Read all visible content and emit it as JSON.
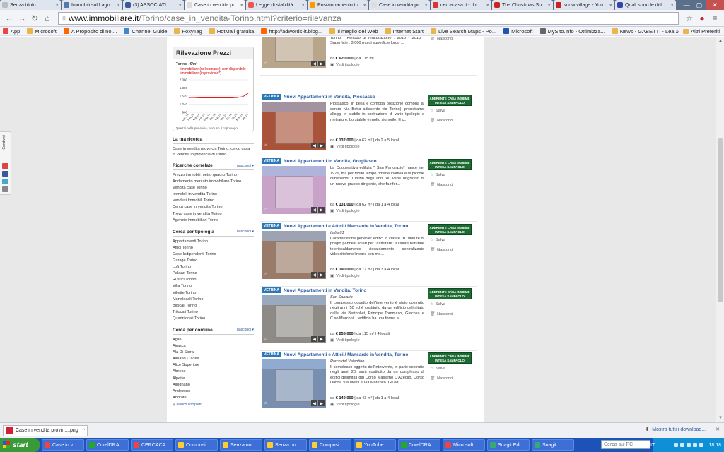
{
  "browser": {
    "tabs": [
      {
        "label": "Senza titolo",
        "color": "#bbb"
      },
      {
        "label": "Immobili sul Lago",
        "color": "#57a"
      },
      {
        "label": "(3) ASSOCIATI",
        "color": "#3b5998"
      },
      {
        "label": "Case in vendita pr",
        "color": "#ddd",
        "active": true
      },
      {
        "label": "Legge di stabilità",
        "color": "#e55"
      },
      {
        "label": "Posizionamento to",
        "color": "#f90"
      },
      {
        "label": "Case in vendita pr",
        "color": "#ddd"
      },
      {
        "label": "cercacasa.it - Il r",
        "color": "#d33"
      },
      {
        "label": "The Christmas So",
        "color": "#c22"
      },
      {
        "label": "snow village - You",
        "color": "#c22"
      },
      {
        "label": "Quali sono le diff",
        "color": "#34a"
      }
    ],
    "window_controls": {
      "minimize": "—",
      "maximize": "▢",
      "close": "✕"
    },
    "nav": {
      "back": "←",
      "forward": "→",
      "reload": "↻",
      "home": "⌂",
      "star": "☆",
      "menu": "≡"
    },
    "url": {
      "host": "www.immobiliare.it",
      "path": "/Torino/case_in_vendita-Torino.html?criterio=rilevanza",
      "page_icon": "▯"
    },
    "bookmarks": [
      {
        "label": "App",
        "color": "#e44"
      },
      {
        "label": "Microsoft",
        "color": "#e8b64c"
      },
      {
        "label": "A Proposito di noi...",
        "color": "#f60"
      },
      {
        "label": "Channel Guide",
        "color": "#48c"
      },
      {
        "label": "FoxyTag",
        "color": "#e8b64c"
      },
      {
        "label": "HotMail gratuita",
        "color": "#e8b64c"
      },
      {
        "label": "http://adwords-it.blog...",
        "color": "#f60"
      },
      {
        "label": "Il meglio del Web",
        "color": "#e8b64c"
      },
      {
        "label": "Internet Start",
        "color": "#e8b64c"
      },
      {
        "label": "Live Search Maps - Po...",
        "color": "#e8b64c"
      },
      {
        "label": "Microsoft",
        "color": "#25a"
      },
      {
        "label": "MySito.info - Ottimizza...",
        "color": "#666"
      },
      {
        "label": "News - GABETTI - Lea...",
        "color": "#e8b64c"
      }
    ],
    "bookmarks_overflow": "»",
    "other_bookmarks": "Altri Preferiti"
  },
  "share": {
    "label": "Condividi",
    "icons": [
      {
        "name": "google-plus",
        "color": "#d44"
      },
      {
        "name": "facebook",
        "color": "#3b5998"
      },
      {
        "name": "twitter",
        "color": "#4ac"
      },
      {
        "name": "email",
        "color": "#888"
      }
    ]
  },
  "sidebar": {
    "rilevazione": {
      "title": "Rilevazione Prezzi",
      "city": "Torino - €/m²",
      "legend1": "— immobiliare (nel comune), non disponibile",
      "legend2": "— immobiliare (in provincia*)",
      "y_ticks": [
        "2.080",
        "1.800",
        "1.520",
        "1.240",
        "960"
      ],
      "note": "*prezzi nella provincia, escluso il capoluogo"
    },
    "tua_ricerca": {
      "title": "La tua ricerca",
      "text": "Case in vendita provincia Torino, cerco casa in vendita in provincia di Torino"
    },
    "ricerche_correlate": {
      "title": "Ricerche correlate",
      "toggle": "nascondi ▾",
      "links": [
        "Prezzo immobili metro quadro Torino",
        "Andamento mercato immobiliare Torino",
        "Vendita case Torino",
        "Immobili in vendita Torino",
        "Vendesi Immobili Torino",
        "Cerca case in vendita Torino",
        "Trova case in vendita Torino",
        "Agenzie immobiliari Torino"
      ]
    },
    "tipologia": {
      "title": "Cerca per tipologia",
      "toggle": "nascondi ▾",
      "links": [
        "Appartamenti Torino",
        "Attici Torino",
        "Case Indipendenti Torino",
        "Garage Torino",
        "Loft Torino",
        "Palazzi Torino",
        "Rustici Torino",
        "Villa Torino",
        "Villette Torino",
        "Monolocali Torino",
        "Bilocali Torino",
        "Trilocali Torino",
        "Quadrilocali Torino"
      ]
    },
    "comune": {
      "title": "Cerca per comune",
      "toggle": "nascondi ▾",
      "links": [
        "Agliè",
        "Airasca",
        "Ala Di Stura",
        "Albiano D'Ivrea",
        "Alice Superiore",
        "Almese",
        "Alpette",
        "Alpignano",
        "Andezeno",
        "Andrate"
      ],
      "footer": "⊞ elenco completo"
    }
  },
  "chart_data": {
    "type": "line",
    "title": "Rilevazione Prezzi",
    "ylabel": "€/m²",
    "ylim": [
      960,
      2080
    ],
    "y_ticks": [
      960,
      1240,
      1520,
      1800,
      2080
    ],
    "categories": [
      "Gen 14",
      "Feb 14",
      "Mar 14",
      "Apr 14",
      "Mag 14",
      "Giu 14",
      "Lug 14",
      "Ago 14",
      "Set 14",
      "Ott 14",
      "Nov 14",
      "Dic 14"
    ],
    "series": [
      {
        "name": "immobiliare (in provincia*)",
        "values": [
          1470,
          1470,
          1460,
          1460,
          1460,
          1460,
          1460,
          1460,
          1460,
          1470,
          1500,
          1620
        ]
      }
    ]
  },
  "listings": [
    {
      "vetrina": "",
      "title": "",
      "location": "Centro Storico",
      "description": "MATTEOTTI 51 - C.so Matteotti 51, Torino GENERALITA': Localizzazione: Corso Matteotti 51, Torino . Periodo di realizzazione : 2010 - 2013 . Superficie : 3.000 mq di superficie lorda ...",
      "price": "€ 620.000",
      "price_detail": "| da 115 m²",
      "price_prefix": "da",
      "tipologie": "Vedi tipologie",
      "badge": "ADERENTE CASA INSIEME INTESA SANPAOLO",
      "salva": "Salva",
      "nascondi": "Nascondi",
      "photo": "#b9a58a"
    },
    {
      "vetrina": "VETRINA",
      "title": "Nuovi Appartamenti in Vendita, Piossasco",
      "location": "",
      "description": "Piossasco, in bella e comoda posizione comoda al centro (via Botta adiacente via Torino), prenotiamo alloggi in stabile in costruzione di varie tipologie e metrature. Lo stabile è molto signorile. E c...",
      "price": "€ 132.000",
      "price_detail": "| da 62 m² | da 2 a 5 locali",
      "price_prefix": "da",
      "tipologie": "Vedi tipologie",
      "badge": "ADERENTE CASA INSIEME INTESA SANPAOLO",
      "salva": "Salva",
      "nascondi": "Nascondi",
      "photo": "#a8533a"
    },
    {
      "vetrina": "VETRINA",
      "title": "Nuovi Appartamenti in Vendita, Grugliasco",
      "location": "",
      "description": "La Cooperativa edilizia \" San Panorazio\" nasce nel 1976, ma per molto tempo rimane inattiva e di piccole dimensioni. L'inizio degli anni '80 vede l'ingresso di un nuovo gruppo dirigente, che fa rifer...",
      "price": "€ 131.000",
      "price_detail": "| da 62 m² | da 1 a 4 locali",
      "price_prefix": "da",
      "tipologie": "Vedi tipologie",
      "badge": "ADERENTE CASA INSIEME INTESA SANPAOLO",
      "salva": "Salva",
      "nascondi": "Nascondi",
      "photo": "#c8a2c8"
    },
    {
      "vetrina": "VETRINA",
      "title": "Nuovi Appartamenti e Attici / Mansarde in Vendita, Torino",
      "location": "Italia 61",
      "description": "Caratteristiche generali: edifici in classe \"B\" finiture di pregio pannelli solari per \"catturare\" il calore naturale teleriscaldamento riscaldamento centralizzato videocitofono lineare con mo...",
      "price": "€ 190.000",
      "price_detail": "| da 77 m² | da 3 a 4 locali",
      "price_prefix": "da",
      "tipologie": "Vedi tipologie",
      "badge": "ADERENTE CASA INSIEME INTESA SANPAOLO",
      "salva": "Salva",
      "nascondi": "Nascondi",
      "photo": "#9a7a68"
    },
    {
      "vetrina": "VETRINA",
      "title": "Nuovi Appartamenti in Vendita, Torino",
      "location": "San Salvario",
      "description": "Il complesso oggetto dell'intervento è stato costruito negli anni '50 ed è costituito da un edificio delimitato dalle vie Berthollet, Principe Tommaso, Giacosa e C.so Marconi. L'edificio ha una forma a ...",
      "price": "€ 255.000",
      "price_detail": "| da 115 m² | 4 locali",
      "price_prefix": "da",
      "tipologie": "Vedi tipologie",
      "badge": "ADERENTE CASA INSIEME INTESA SANPAOLO",
      "salva": "Salva",
      "nascondi": "Nascondi",
      "photo": "#8e8a86"
    },
    {
      "vetrina": "VETRINA",
      "title": "Nuovi Appartamenti e Attici / Mansarde in Vendita, Torino",
      "location": "Parco del Valentino",
      "description": "Il complesso oggetto dell'intervento, in parte costruito negli anni '20, sarà costituito da un complesso di edifici delimitati dal Corso Massimo D'Azeglio, Corso Dante, Via Monti e Via Marenco. Gli ed...",
      "price": "€ 140.000",
      "price_detail": "| da 43 m² | da 1 a 4 locali",
      "price_prefix": "da",
      "tipologie": "Vedi tipologie",
      "badge": "ADERENTE CASA INSIEME INTESA SANPAOLO",
      "salva": "Salva",
      "nascondi": "Nascondi",
      "photo": "#7a8fb0"
    }
  ],
  "scrollbar": {
    "up": "▲",
    "down": "▼"
  },
  "download_bar": {
    "file": "Case in vendita provin....png",
    "chevron": "^",
    "show_all": "Mostra tutti i download...",
    "close": "✕"
  },
  "taskbar": {
    "start": "start",
    "buttons": [
      {
        "label": "Case in v...",
        "color": "#e44"
      },
      {
        "label": "CorelDRA...",
        "color": "#2a2"
      },
      {
        "label": "CERCACA...",
        "color": "#e44"
      },
      {
        "label": "Composi...",
        "color": "#fc3"
      },
      {
        "label": "Senza no...",
        "color": "#fc3"
      },
      {
        "label": "Senza no...",
        "color": "#fc3"
      },
      {
        "label": "Composi...",
        "color": "#fc3"
      },
      {
        "label": "YouTube ...",
        "color": "#fc3"
      },
      {
        "label": "CorelDRA...",
        "color": "#2a2"
      },
      {
        "label": "Microsoft ...",
        "color": "#e44"
      },
      {
        "label": "Snagit Edi...",
        "color": "#3a7"
      },
      {
        "label": "Snagit",
        "color": "#3a7"
      }
    ],
    "search": "Cerca sul PC",
    "lang": "IT",
    "time": "18.18"
  }
}
